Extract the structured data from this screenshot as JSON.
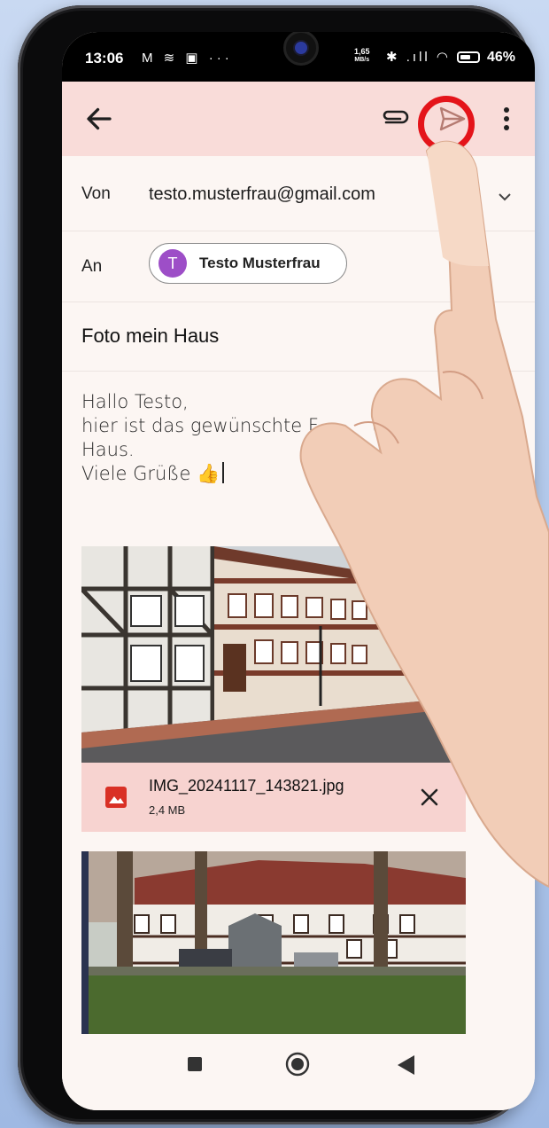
{
  "status_bar": {
    "time": "13:06",
    "left_icons": "M ≋ ▣ ···",
    "speed_value": "1,65",
    "speed_unit": "MB/s",
    "right_icons": "✱ .ıll ◠",
    "battery": "46%"
  },
  "toolbar": {
    "back_icon": "arrow-left-icon",
    "attach_icon": "paperclip-icon",
    "send_icon": "send-icon",
    "more_icon": "more-vert-icon",
    "highlight_color": "#e4141a"
  },
  "compose": {
    "from_label": "Von",
    "from_value": "testo.musterfrau@gmail.com",
    "to_label": "An",
    "recipient_initial": "T",
    "recipient_name": "Testo Musterfrau",
    "recipient_color": "#9d4ec7",
    "subject": "Foto mein Haus",
    "body_lines": [
      "Hallo Testo,",
      "hier ist das gewünschte F         unserem",
      "Haus.",
      "Viele Grüße 👍"
    ]
  },
  "attachment": {
    "filename": "IMG_20241117_143821.jpg",
    "size": "2,4 MB",
    "icon": "image-icon",
    "remove_icon": "close-icon",
    "bg_color": "#f7d3d0"
  },
  "nav": {
    "recents_icon": "square-icon",
    "home_icon": "circle-icon",
    "back_icon": "triangle-back-icon"
  }
}
